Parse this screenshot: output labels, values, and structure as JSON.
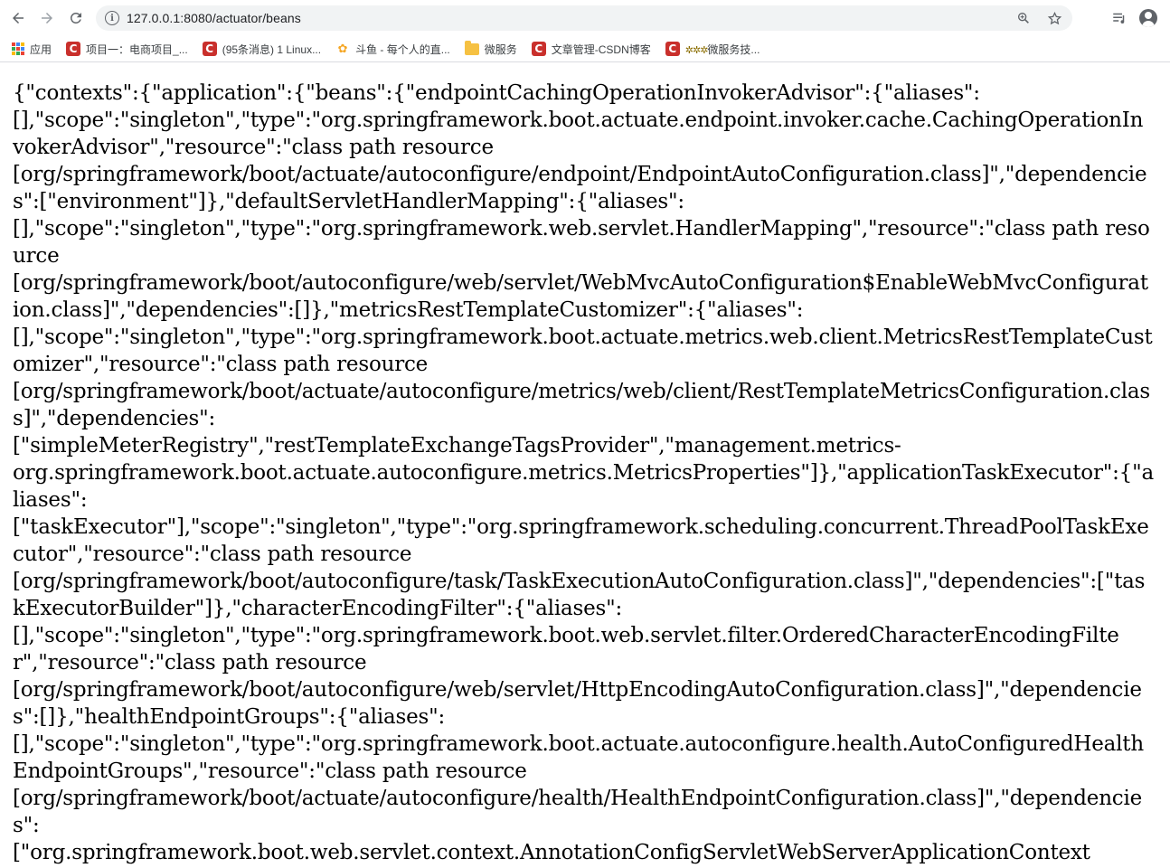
{
  "browser": {
    "url": "127.0.0.1:8080/actuator/beans",
    "icons": {
      "back": "arrow-left-icon",
      "forward": "arrow-right-icon",
      "reload": "reload-icon",
      "site_info": "info-icon",
      "zoom": "zoom-icon",
      "bookmark": "star-icon",
      "media": "media-queue-icon",
      "profile": "account-icon"
    }
  },
  "bookmarks": [
    {
      "label": "应用",
      "icon": "apps-grid-icon"
    },
    {
      "label": "项目一：电商项目_...",
      "icon": "csdn-icon"
    },
    {
      "label": "(95条消息) 1 Linux...",
      "icon": "csdn-icon"
    },
    {
      "label": "斗鱼 - 每个人的直...",
      "icon": "douyu-icon"
    },
    {
      "label": "微服务",
      "icon": "folder-icon"
    },
    {
      "label": "文章管理-CSDN博客",
      "icon": "csdn-icon"
    },
    {
      "label": "微服务技...",
      "prefix": "✲✲✲",
      "icon": "csdn-icon"
    }
  ],
  "page": {
    "json_text": "{\"contexts\":{\"application\":{\"beans\":{\"endpointCachingOperationInvokerAdvisor\":{\"aliases\":\n[],\"scope\":\"singleton\",\"type\":\"org.springframework.boot.actuate.endpoint.invoker.cache.CachingOperationInvokerAdvisor\",\"resource\":\"class path resource\n[org/springframework/boot/actuate/autoconfigure/endpoint/EndpointAutoConfiguration.class]\",\"dependencies\":[\"environment\"]},\"defaultServletHandlerMapping\":{\"aliases\":\n[],\"scope\":\"singleton\",\"type\":\"org.springframework.web.servlet.HandlerMapping\",\"resource\":\"class path resource\n[org/springframework/boot/autoconfigure/web/servlet/WebMvcAutoConfiguration$EnableWebMvcConfiguration.class]\",\"dependencies\":[]},\"metricsRestTemplateCustomizer\":{\"aliases\":\n[],\"scope\":\"singleton\",\"type\":\"org.springframework.boot.actuate.metrics.web.client.MetricsRestTemplateCustomizer\",\"resource\":\"class path resource\n[org/springframework/boot/actuate/autoconfigure/metrics/web/client/RestTemplateMetricsConfiguration.class]\",\"dependencies\":\n[\"simpleMeterRegistry\",\"restTemplateExchangeTagsProvider\",\"management.metrics-\norg.springframework.boot.actuate.autoconfigure.metrics.MetricsProperties\"]},\"applicationTaskExecutor\":{\"aliases\":\n[\"taskExecutor\"],\"scope\":\"singleton\",\"type\":\"org.springframework.scheduling.concurrent.ThreadPoolTaskExecutor\",\"resource\":\"class path resource\n[org/springframework/boot/autoconfigure/task/TaskExecutionAutoConfiguration.class]\",\"dependencies\":[\"taskExecutorBuilder\"]},\"characterEncodingFilter\":{\"aliases\":\n[],\"scope\":\"singleton\",\"type\":\"org.springframework.boot.web.servlet.filter.OrderedCharacterEncodingFilter\",\"resource\":\"class path resource\n[org/springframework/boot/autoconfigure/web/servlet/HttpEncodingAutoConfiguration.class]\",\"dependencies\":[]},\"healthEndpointGroups\":{\"aliases\":\n[],\"scope\":\"singleton\",\"type\":\"org.springframework.boot.actuate.autoconfigure.health.AutoConfiguredHealthEndpointGroups\",\"resource\":\"class path resource\n[org/springframework/boot/actuate/autoconfigure/health/HealthEndpointConfiguration.class]\",\"dependencies\":\n[\"org.springframework.boot.web.servlet.context.AnnotationConfigServletWebServerApplicationContext"
  },
  "colors": {
    "toolbar_bg": "#ffffff",
    "omnibox_bg": "#f1f3f4",
    "icon": "#5f6368",
    "csdn_red": "#c9302c",
    "folder_yellow": "#f6c142"
  }
}
